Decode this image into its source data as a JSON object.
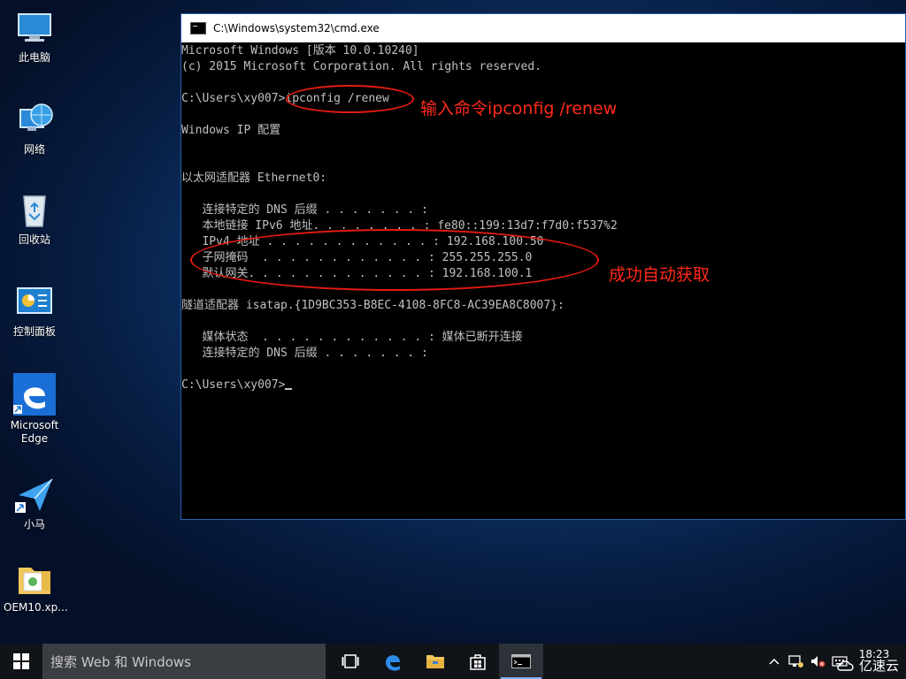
{
  "desktop": {
    "icons": [
      {
        "label": "此电脑"
      },
      {
        "label": "网络"
      },
      {
        "label": "回收站"
      },
      {
        "label": "控制面板"
      },
      {
        "label": "Microsoft Edge"
      },
      {
        "label": "小马"
      },
      {
        "label": "OEM10.xp..."
      }
    ]
  },
  "cmd_window": {
    "title": "C:\\Windows\\system32\\cmd.exe",
    "lines": [
      "Microsoft Windows [版本 10.0.10240]",
      "(c) 2015 Microsoft Corporation. All rights reserved.",
      "",
      "C:\\Users\\xy007>ipconfig /renew",
      "",
      "Windows IP 配置",
      "",
      "",
      "以太网适配器 Ethernet0:",
      "",
      "   连接特定的 DNS 后缀 . . . . . . . :",
      "   本地链接 IPv6 地址. . . . . . . . : fe80::199:13d7:f7d0:f537%2",
      "   IPv4 地址 . . . . . . . . . . . . : 192.168.100.50",
      "   子网掩码  . . . . . . . . . . . . : 255.255.255.0",
      "   默认网关. . . . . . . . . . . . . : 192.168.100.1",
      "",
      "隧道适配器 isatap.{1D9BC353-B8EC-4108-8FC8-AC39EA8C8007}:",
      "",
      "   媒体状态  . . . . . . . . . . . . : 媒体已断开连接",
      "   连接特定的 DNS 后缀 . . . . . . . :",
      "",
      "C:\\Users\\xy007>"
    ]
  },
  "annotations": {
    "command_note": "输入命令ipconfig /renew",
    "success_note": "成功自动获取"
  },
  "taskbar": {
    "search_placeholder": "搜索 Web 和 Windows",
    "clock_time": "18:23",
    "watermark": "亿速云"
  },
  "colors": {
    "annotation": "#ff2a1a",
    "console_text": "#c0c0c0",
    "taskbar": "#101317"
  }
}
